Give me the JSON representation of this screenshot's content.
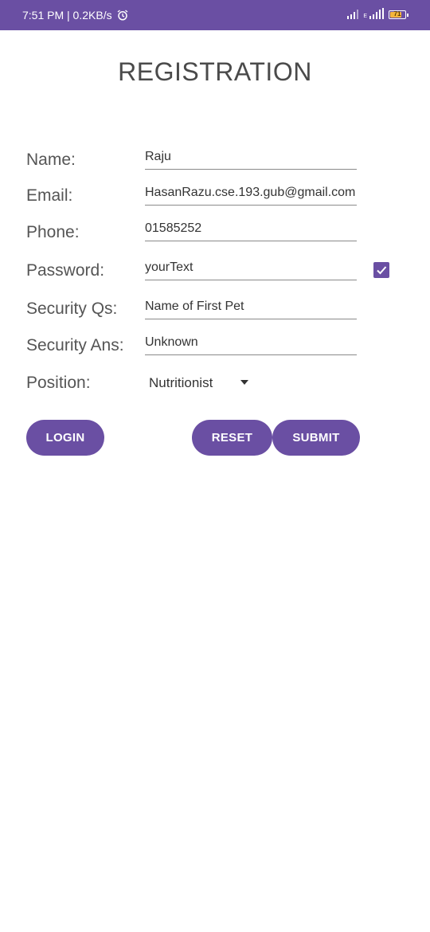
{
  "status_bar": {
    "time_speed": "7:51 PM | 0.2KB/s",
    "network_label": "E",
    "battery_level": "71",
    "colors": {
      "bar": "#6a4fa3",
      "battery_fill": "#f5b63b"
    },
    "icons": [
      "alarm-icon",
      "signal-icon",
      "signal-icon",
      "battery-icon"
    ]
  },
  "page": {
    "title": "REGISTRATION"
  },
  "form": {
    "name_label": "Name:",
    "name_value": "Raju",
    "email_label": "Email:",
    "email_value": "HasanRazu.cse.193.gub@gmail.com",
    "phone_label": "Phone:",
    "phone_value": "01585252",
    "password_label": "Password:",
    "password_value": "yourText",
    "show_password_checked": true,
    "security_q_label": "Security Qs:",
    "security_q_value": "Name of First Pet",
    "security_ans_label": "Security Ans:",
    "security_ans_value": "Unknown",
    "position_label": "Position:",
    "position_value": "Nutritionist"
  },
  "buttons": {
    "login": "LOGIN",
    "reset": "RESET",
    "submit": "SUBMIT",
    "color": "#6a4fa3"
  }
}
